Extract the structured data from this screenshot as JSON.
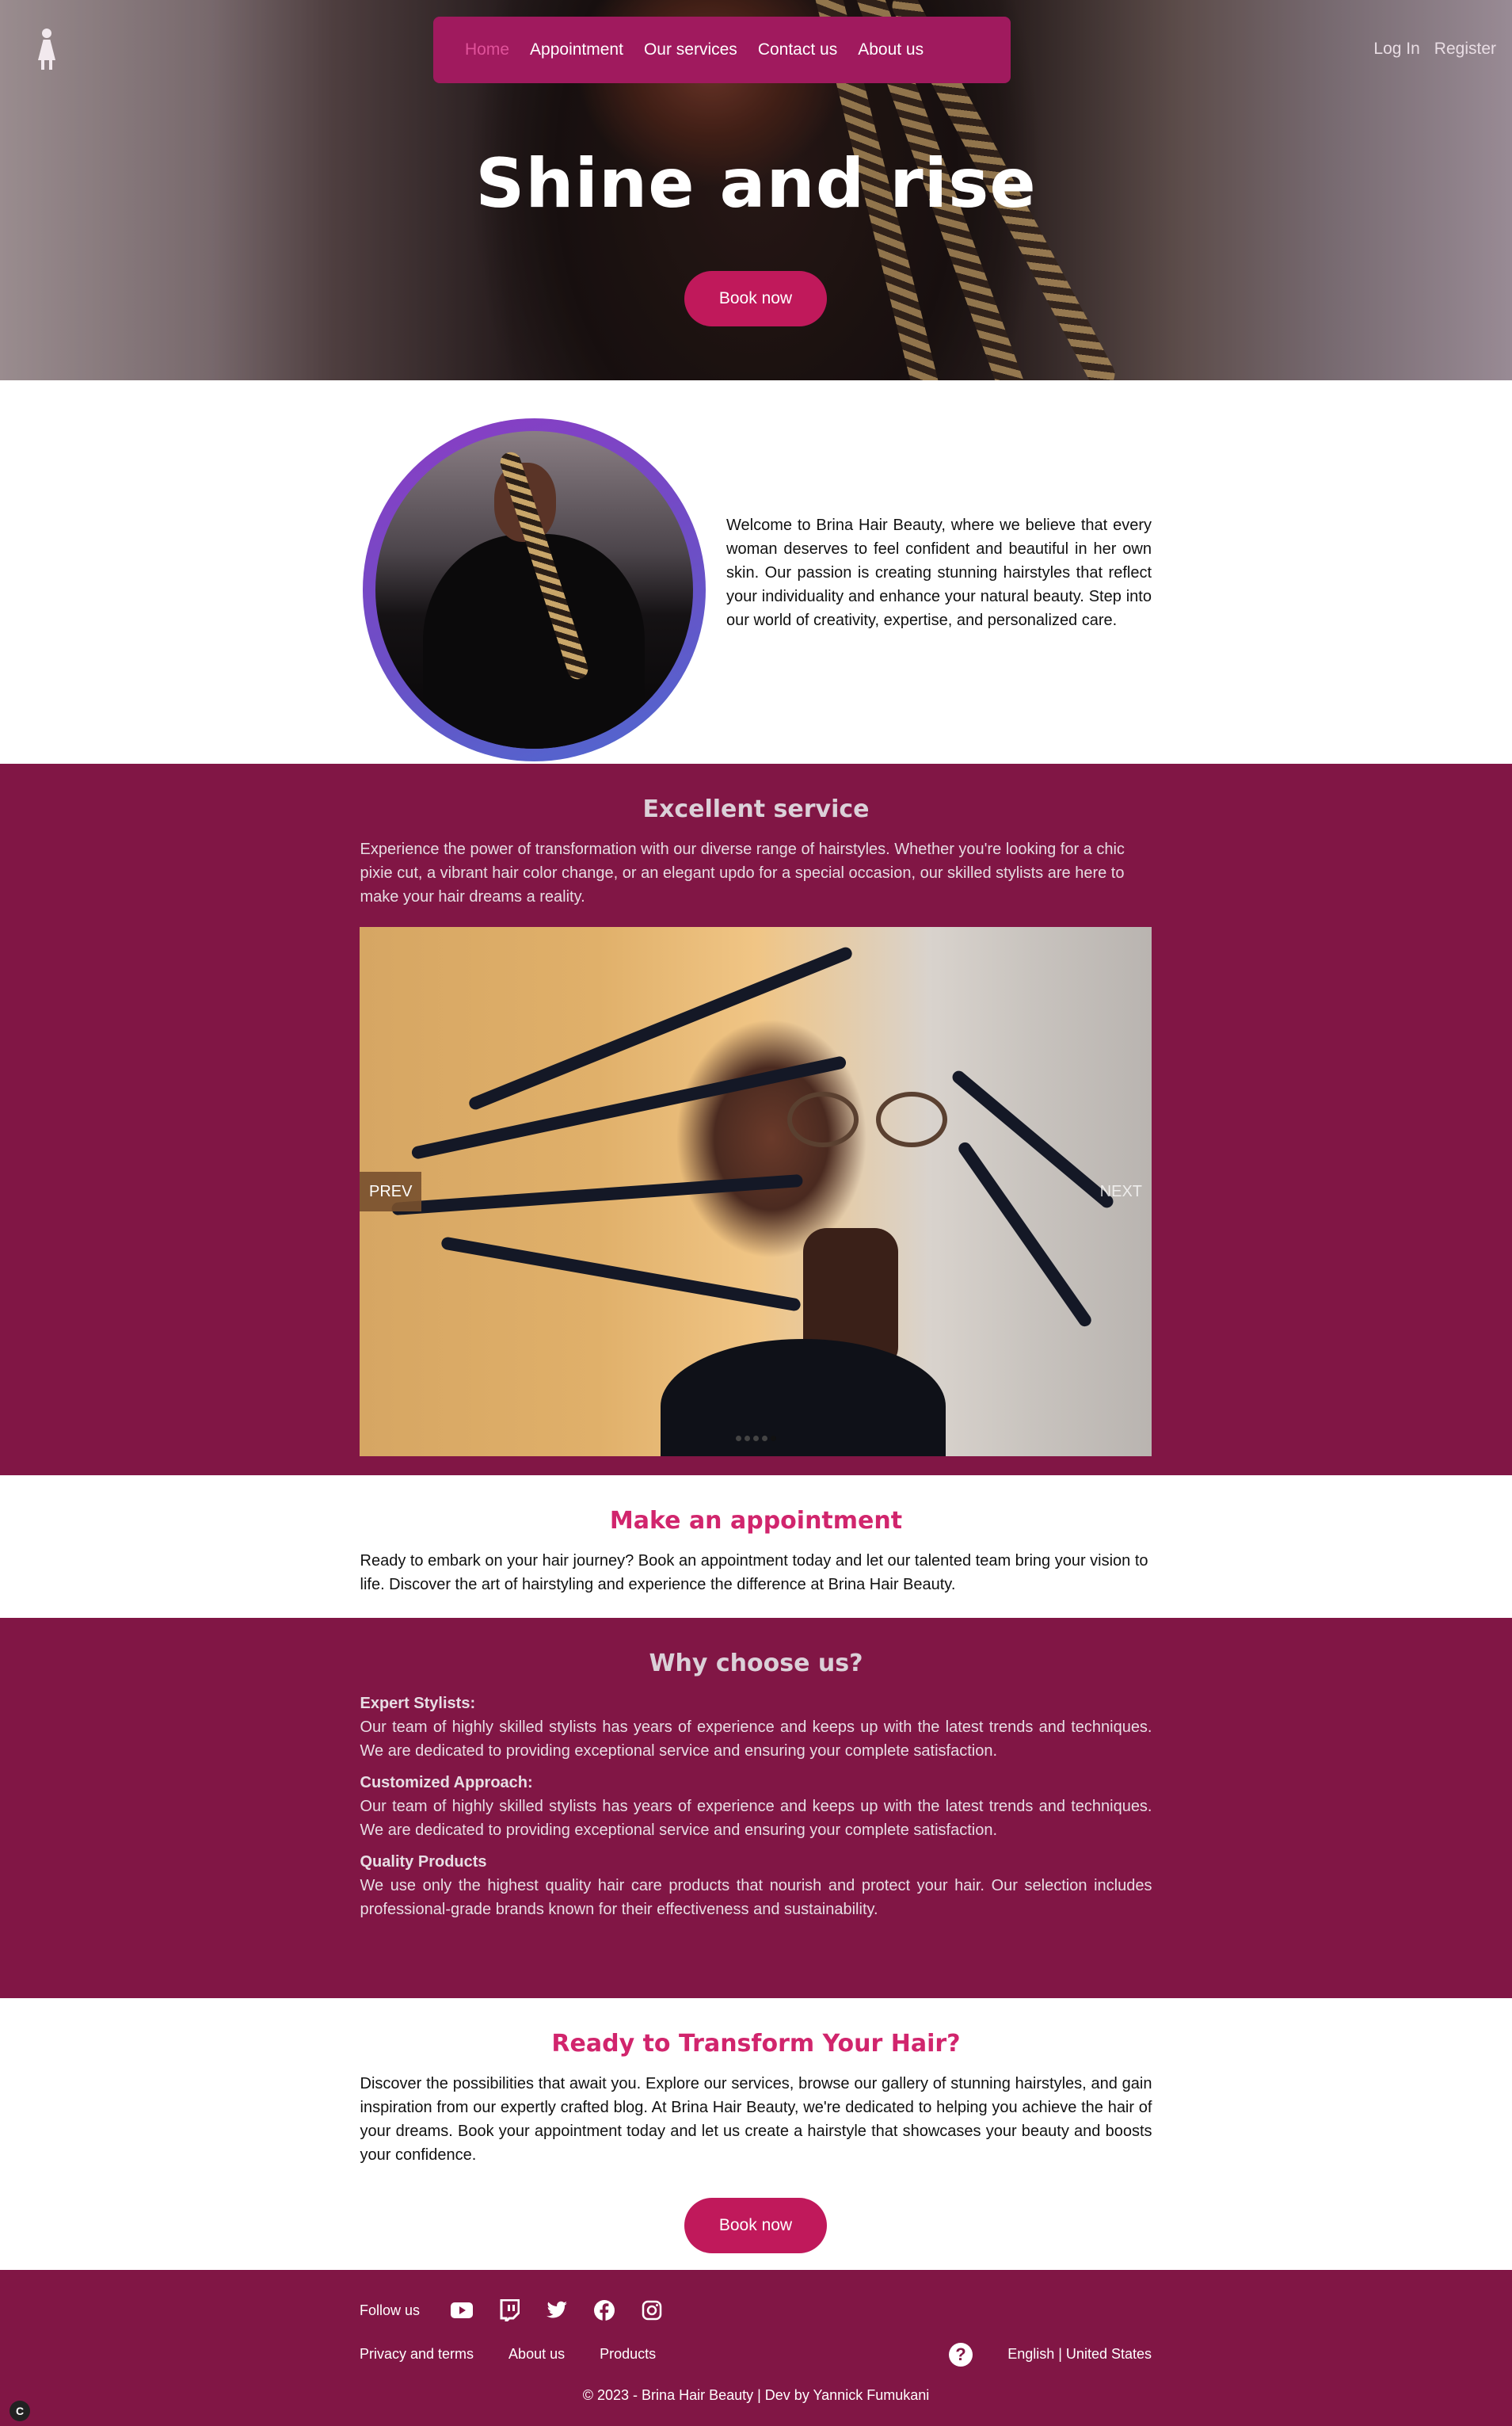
{
  "nav": {
    "links": [
      "Home",
      "Appointment",
      "Our services",
      "Contact us",
      "About us"
    ],
    "active": "Home"
  },
  "auth": {
    "login": "Log In",
    "register": "Register"
  },
  "hero": {
    "title": "Shine and rise",
    "cta": "Book now"
  },
  "intro": {
    "text": "Welcome to Brina Hair Beauty, where we believe that every woman deserves to feel confident and beautiful in her own skin. Our passion is creating stunning hairstyles that reflect your individuality and enhance your natural beauty. Step into our world of creativity, expertise, and personalized care."
  },
  "service": {
    "title": "Excellent service",
    "text": "Experience the power of transformation with our diverse range of hairstyles. Whether you're looking for a chic pixie cut, a vibrant hair color change, or an elegant updo for a special occasion, our skilled stylists are here to make your hair dreams a reality.",
    "prev_label": "PREV",
    "next_label": "NEXT",
    "slide_count": 5,
    "active_slide": 5
  },
  "appointment": {
    "title": "Make an appointment",
    "text": "Ready to embark on your hair journey? Book an appointment today and let our talented team bring your vision to life. Discover the art of hairstyling and experience the difference at Brina Hair Beauty."
  },
  "why": {
    "title": "Why choose us?",
    "items": [
      {
        "heading": "Expert Stylists:",
        "text": "Our team of highly skilled stylists has years of experience and keeps up with the latest trends and techniques. We are dedicated to providing exceptional service and ensuring your complete satisfaction."
      },
      {
        "heading": "Customized Approach:",
        "text": "Our team of highly skilled stylists has years of experience and keeps up with the latest trends and techniques. We are dedicated to providing exceptional service and ensuring your complete satisfaction."
      },
      {
        "heading": "Quality Products",
        "text": "We use only the highest quality hair care products that nourish and protect your hair. Our selection includes professional-grade brands known for their effectiveness and sustainability."
      }
    ]
  },
  "transform": {
    "title": "Ready to Transform Your Hair?",
    "text": "Discover the possibilities that await you. Explore our services, browse our gallery of stunning hairstyles, and gain inspiration from our expertly crafted blog. At Brina Hair Beauty, we're dedicated to helping you achieve the hair of your dreams. Book your appointment today and let us create a hairstyle that showcases your beauty and boosts your confidence.",
    "cta": "Book now"
  },
  "footer": {
    "follow_label": "Follow us",
    "social_icons": [
      "youtube-icon",
      "twitch-icon",
      "twitter-icon",
      "facebook-icon",
      "instagram-icon"
    ],
    "links": [
      "Privacy and terms",
      "About us",
      "Products"
    ],
    "help_icon": "help-icon",
    "locale": "English | United States",
    "copyright": "© 2023 - Brina Hair Beauty | Dev by Yannick Fumukani"
  },
  "colors": {
    "brand": "#811645",
    "nav_bg": "#a01a5e",
    "accent": "#c0195b",
    "heading_pink": "#d1256d",
    "nav_active": "#e0529a"
  }
}
